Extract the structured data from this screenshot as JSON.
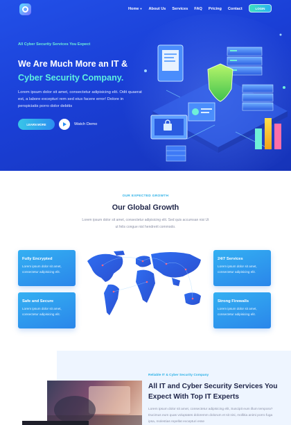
{
  "nav": {
    "items": [
      {
        "label": "Home",
        "has_dropdown": true
      },
      {
        "label": "About Us"
      },
      {
        "label": "Services"
      },
      {
        "label": "FAQ"
      },
      {
        "label": "Pricing"
      },
      {
        "label": "Contact"
      }
    ],
    "login_label": "LOGIN"
  },
  "hero": {
    "kicker": "All Cyber Security Services You Expect",
    "title_line1": "We Are Much More an IT &",
    "title_line2": "Cyber Security Company.",
    "description": "Lorem ipsum dolor sit amet, consectetur adipisicing elit. Odit quaerat est, a labore excepturi rem sed eius facere error! Dolore in perspiciatis porro dolor debitis",
    "learn_more_label": "LEARN MORE",
    "watch_label": "Watch Demo"
  },
  "growth": {
    "kicker": "OUR EXPECTED GROWTH",
    "title": "Our Global Growth",
    "description": "Lorem ipsum dolor sit amet, consectetur adipisicing elit. Sed quis accumsan nisi Ut ut felis congue nisl hendrerit commodo.",
    "features": [
      {
        "title": "Fully Encrypted",
        "desc": "Lorem ipsum dolor sit amet, consectetur adipisicing elit."
      },
      {
        "title": "Safe and Secure",
        "desc": "Lorem ipsum dolor sit amet, consectetur adipisicing elit."
      },
      {
        "title": "24/7 Services",
        "desc": "Lorem ipsum dolor sit amet, consectetur adipisicing elit."
      },
      {
        "title": "Strong Firewalls",
        "desc": "Lorem ipsum dolor sit amet, consectetur adipisicing elit."
      }
    ]
  },
  "about": {
    "kicker": "Reliable IT & Cyber Security Company",
    "title": "All IT and Cyber Security Services You Expect With Top IT Experts",
    "description": "Lorem ipsum dolor sit amet, consectetur adipisicing elit, Suscipit eum illum tempora? Ducimus eum quas voluptates doloremm dolorum et sit nisi, mollitia animi porro fuga ipsa, molestias repellat excepturi esse"
  },
  "colors": {
    "hero_bg": "#1a3fd6",
    "accent_teal": "#5ef0e0",
    "accent_blue": "#2b8ef0",
    "card_blue": "#34b0f2",
    "heading": "#1e2447"
  }
}
